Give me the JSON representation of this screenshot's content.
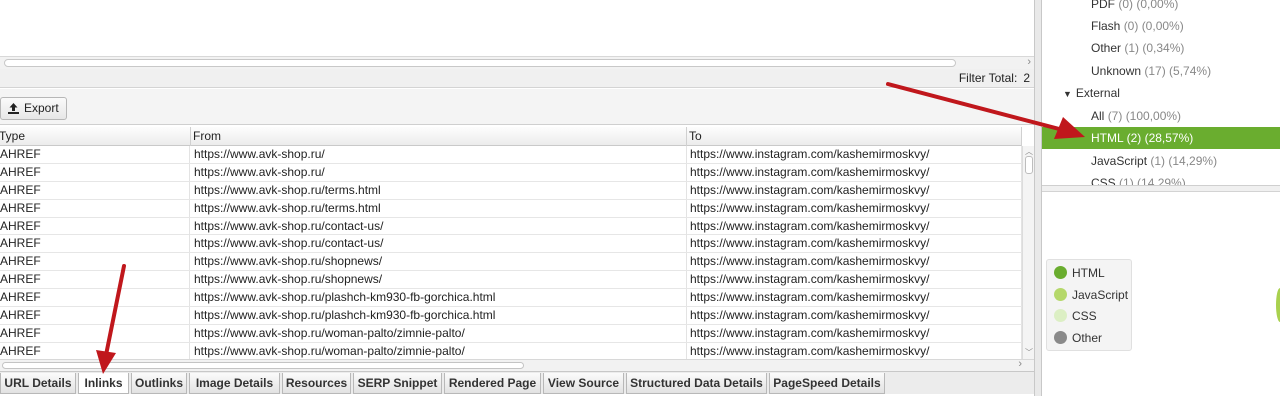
{
  "filter": {
    "label": "Filter Total:",
    "value": "2"
  },
  "toolbar": {
    "export_label": "Export"
  },
  "table": {
    "columns": [
      "Type",
      "From",
      "To"
    ],
    "rows": [
      [
        "AHREF",
        "https://www.avk-shop.ru/",
        "https://www.instagram.com/kashemirmoskvy/"
      ],
      [
        "AHREF",
        "https://www.avk-shop.ru/",
        "https://www.instagram.com/kashemirmoskvy/"
      ],
      [
        "AHREF",
        "https://www.avk-shop.ru/terms.html",
        "https://www.instagram.com/kashemirmoskvy/"
      ],
      [
        "AHREF",
        "https://www.avk-shop.ru/terms.html",
        "https://www.instagram.com/kashemirmoskvy/"
      ],
      [
        "AHREF",
        "https://www.avk-shop.ru/contact-us/",
        "https://www.instagram.com/kashemirmoskvy/"
      ],
      [
        "AHREF",
        "https://www.avk-shop.ru/contact-us/",
        "https://www.instagram.com/kashemirmoskvy/"
      ],
      [
        "AHREF",
        "https://www.avk-shop.ru/shopnews/",
        "https://www.instagram.com/kashemirmoskvy/"
      ],
      [
        "AHREF",
        "https://www.avk-shop.ru/shopnews/",
        "https://www.instagram.com/kashemirmoskvy/"
      ],
      [
        "AHREF",
        "https://www.avk-shop.ru/plashch-km930-fb-gorchica.html",
        "https://www.instagram.com/kashemirmoskvy/"
      ],
      [
        "AHREF",
        "https://www.avk-shop.ru/plashch-km930-fb-gorchica.html",
        "https://www.instagram.com/kashemirmoskvy/"
      ],
      [
        "AHREF",
        "https://www.avk-shop.ru/woman-palto/zimnie-palto/",
        "https://www.instagram.com/kashemirmoskvy/"
      ],
      [
        "AHREF",
        "https://www.avk-shop.ru/woman-palto/zimnie-palto/",
        "https://www.instagram.com/kashemirmoskvy/"
      ]
    ]
  },
  "tabs": [
    {
      "label": "URL Details",
      "active": false
    },
    {
      "label": "Inlinks",
      "active": true
    },
    {
      "label": "Outlinks",
      "active": false
    },
    {
      "label": "Image Details",
      "active": false
    },
    {
      "label": "Resources",
      "active": false
    },
    {
      "label": "SERP Snippet",
      "active": false
    },
    {
      "label": "Rendered Page",
      "active": false
    },
    {
      "label": "View Source",
      "active": false
    },
    {
      "label": "Structured Data Details",
      "active": false
    },
    {
      "label": "PageSpeed Details",
      "active": false
    }
  ],
  "tree": {
    "items": [
      {
        "label": "PDF",
        "count": "(0) (0,00%)"
      },
      {
        "label": "Flash",
        "count": "(0) (0,00%)"
      },
      {
        "label": "Other",
        "count": "(1) (0,34%)"
      },
      {
        "label": "Unknown",
        "count": "(17) (5,74%)"
      },
      {
        "label": "External",
        "count": "",
        "group": true,
        "toggle": "▼"
      },
      {
        "label": "All",
        "count": "(7) (100,00%)"
      },
      {
        "label": "HTML",
        "count": "(2) (28,57%)",
        "selected": true
      },
      {
        "label": "JavaScript",
        "count": "(1) (14,29%)"
      },
      {
        "label": "CSS",
        "count": "(1) (14,29%)"
      }
    ]
  },
  "legend": {
    "items": [
      {
        "label": "HTML",
        "color": "#6aad2f"
      },
      {
        "label": "JavaScript",
        "color": "#b5d86a"
      },
      {
        "label": "CSS",
        "color": "#dcefc4"
      },
      {
        "label": "Other",
        "color": "#8a8a8a"
      }
    ]
  },
  "colors": {
    "selected": "#6aad2f",
    "annotation_arrow": "#c0171c"
  },
  "icons": {
    "export": "upload-icon",
    "tree_toggle": "triangle-down-icon"
  }
}
